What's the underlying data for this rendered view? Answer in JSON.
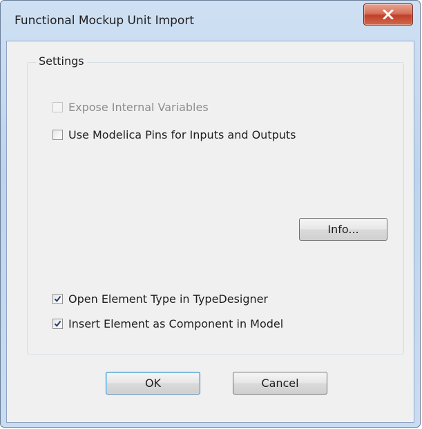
{
  "window": {
    "title": "Functional Mockup Unit Import"
  },
  "settings": {
    "group_label": "Settings",
    "expose_internal": {
      "label": "Expose Internal Variables",
      "checked": false,
      "enabled": false
    },
    "use_modelica_pins": {
      "label": "Use Modelica Pins for Inputs and Outputs",
      "checked": false,
      "enabled": true
    },
    "info_button": "Info...",
    "open_type_designer": {
      "label": "Open Element Type in TypeDesigner",
      "checked": true,
      "enabled": true
    },
    "insert_as_component": {
      "label": "Insert Element as Component in Model",
      "checked": true,
      "enabled": true
    }
  },
  "buttons": {
    "ok": "OK",
    "cancel": "Cancel"
  },
  "colors": {
    "accent": "#3c7fb1",
    "close": "#c1402a",
    "checkmark": "#1f3a6b"
  }
}
